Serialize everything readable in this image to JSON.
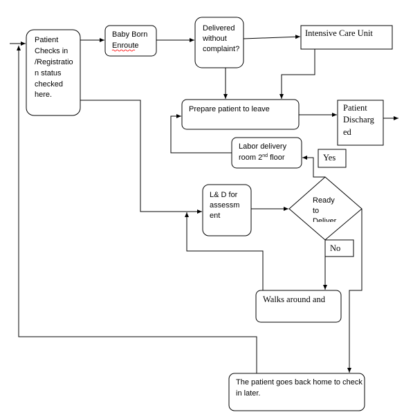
{
  "nodes": {
    "patient_checks_in": {
      "lines": [
        "Patient",
        "Checks in",
        "/Registratio",
        "n status",
        "checked",
        "here."
      ]
    },
    "baby_born_enroute": {
      "lines": [
        "Baby Born",
        "Enroute"
      ]
    },
    "delivered_without_complaint": {
      "lines": [
        "Delivered",
        "without",
        "complaint?"
      ]
    },
    "intensive_care_unit": {
      "lines": [
        "Intensive Care Unit"
      ]
    },
    "prepare_patient": {
      "lines": [
        "Prepare patient to leave"
      ]
    },
    "patient_discharged": {
      "lines": [
        "Patient",
        "Discharg",
        "ed"
      ]
    },
    "labor_delivery_room": {
      "lines": [
        "Labor delivery",
        "room 2",
        "nd",
        " floor"
      ]
    },
    "yes_label": {
      "lines": [
        "Yes"
      ]
    },
    "ld_assessment": {
      "lines": [
        "L& D for",
        "assessm",
        "ent"
      ]
    },
    "ready_to_deliver": {
      "lines": [
        "Ready",
        "to",
        "Deliver"
      ]
    },
    "no_label": {
      "lines": [
        "No"
      ]
    },
    "walks_around": {
      "lines": [
        "Walks around and"
      ]
    },
    "back_home": {
      "lines": [
        "The patient goes back home to check",
        "in later."
      ]
    }
  },
  "colors": {
    "stroke": "#000000",
    "background": "#ffffff",
    "spellcheck_underline": "#ff0000"
  }
}
